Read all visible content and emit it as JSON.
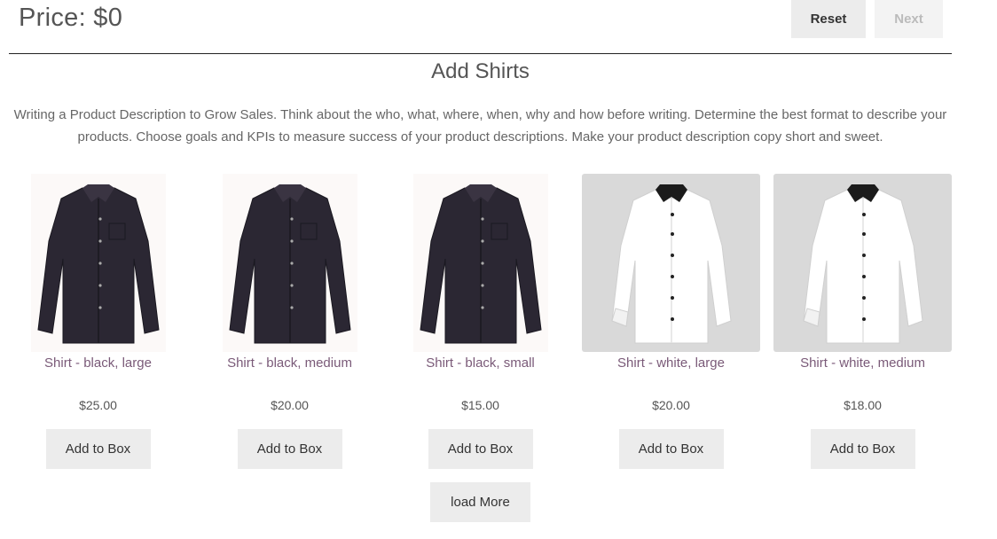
{
  "header": {
    "price_label": "Price: $0",
    "reset_label": "Reset",
    "next_label": "Next"
  },
  "section": {
    "title": "Add Shirts",
    "description": "Writing a Product Description to Grow Sales. Think about the who, what, where, when, why and how before writing. Determine the best format to describe your products. Choose goals and KPIs to measure success of your product descriptions. Make your product description copy short and sweet."
  },
  "products": [
    {
      "name": "Shirt - black, large",
      "price": "$25.00",
      "button": "Add to Box",
      "image": "black-shirt-image",
      "shirt_color": "#2b2733"
    },
    {
      "name": "Shirt - black, medium",
      "price": "$20.00",
      "button": "Add to Box",
      "image": "black-shirt-image",
      "shirt_color": "#2b2733"
    },
    {
      "name": "Shirt - black, small",
      "price": "$15.00",
      "button": "Add to Box",
      "image": "black-shirt-image",
      "shirt_color": "#2b2733"
    },
    {
      "name": "Shirt - white, large",
      "price": "$20.00",
      "button": "Add to Box",
      "image": "white-shirt-image",
      "shirt_color": "#ffffff"
    },
    {
      "name": "Shirt - white, medium",
      "price": "$18.00",
      "button": "Add to Box",
      "image": "white-shirt-image",
      "shirt_color": "#ffffff"
    }
  ],
  "load_more_label": "load More",
  "colors": {
    "product_name": "#7a5a78",
    "button_bg": "#ececec",
    "divider": "#222222"
  }
}
